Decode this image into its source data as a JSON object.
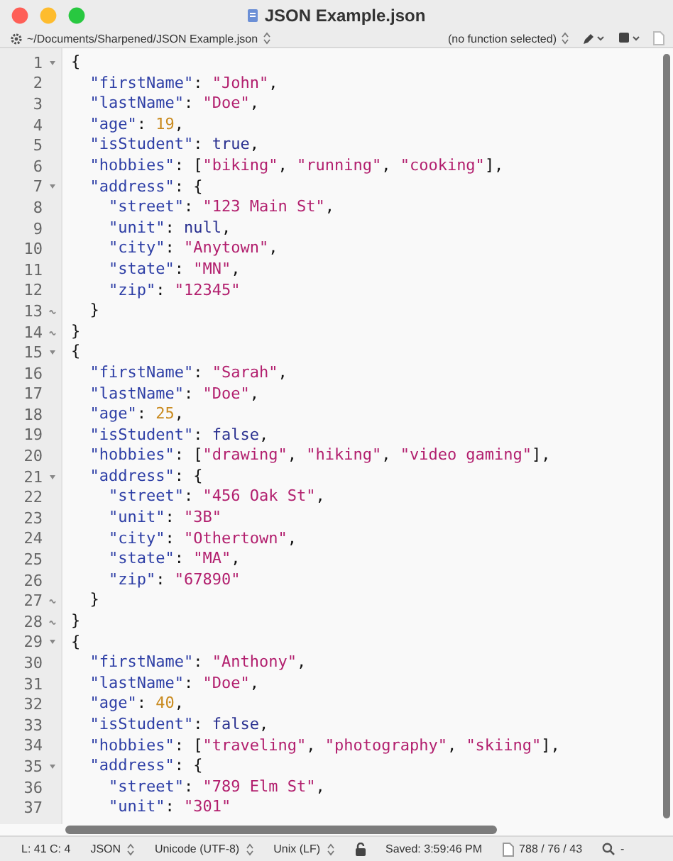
{
  "window": {
    "title": "JSON Example.json"
  },
  "path_bar": {
    "path": "~/Documents/Sharpened/JSON Example.json",
    "function_menu": "(no function selected)"
  },
  "editor": {
    "lines": [
      {
        "number": "1",
        "fold_start": true,
        "tokens": [
          {
            "kind": "punct",
            "text": "{"
          }
        ]
      },
      {
        "number": "2",
        "tokens": [
          {
            "kind": "key",
            "text": "  \"firstName\""
          },
          {
            "kind": "punct",
            "text": ": "
          },
          {
            "kind": "string",
            "text": "\"John\""
          },
          {
            "kind": "punct",
            "text": ","
          }
        ]
      },
      {
        "number": "3",
        "tokens": [
          {
            "kind": "key",
            "text": "  \"lastName\""
          },
          {
            "kind": "punct",
            "text": ": "
          },
          {
            "kind": "string",
            "text": "\"Doe\""
          },
          {
            "kind": "punct",
            "text": ","
          }
        ]
      },
      {
        "number": "4",
        "tokens": [
          {
            "kind": "key",
            "text": "  \"age\""
          },
          {
            "kind": "punct",
            "text": ": "
          },
          {
            "kind": "number",
            "text": "19"
          },
          {
            "kind": "punct",
            "text": ","
          }
        ]
      },
      {
        "number": "5",
        "tokens": [
          {
            "kind": "key",
            "text": "  \"isStudent\""
          },
          {
            "kind": "punct",
            "text": ": "
          },
          {
            "kind": "keyword",
            "text": "true"
          },
          {
            "kind": "punct",
            "text": ","
          }
        ]
      },
      {
        "number": "6",
        "tokens": [
          {
            "kind": "key",
            "text": "  \"hobbies\""
          },
          {
            "kind": "punct",
            "text": ": ["
          },
          {
            "kind": "string",
            "text": "\"biking\""
          },
          {
            "kind": "punct",
            "text": ", "
          },
          {
            "kind": "string",
            "text": "\"running\""
          },
          {
            "kind": "punct",
            "text": ", "
          },
          {
            "kind": "string",
            "text": "\"cooking\""
          },
          {
            "kind": "punct",
            "text": "],"
          }
        ]
      },
      {
        "number": "7",
        "fold_start": true,
        "tokens": [
          {
            "kind": "key",
            "text": "  \"address\""
          },
          {
            "kind": "punct",
            "text": ": {"
          }
        ]
      },
      {
        "number": "8",
        "tokens": [
          {
            "kind": "key",
            "text": "    \"street\""
          },
          {
            "kind": "punct",
            "text": ": "
          },
          {
            "kind": "string",
            "text": "\"123 Main St\""
          },
          {
            "kind": "punct",
            "text": ","
          }
        ]
      },
      {
        "number": "9",
        "tokens": [
          {
            "kind": "key",
            "text": "    \"unit\""
          },
          {
            "kind": "punct",
            "text": ": "
          },
          {
            "kind": "keyword",
            "text": "null"
          },
          {
            "kind": "punct",
            "text": ","
          }
        ]
      },
      {
        "number": "10",
        "tokens": [
          {
            "kind": "key",
            "text": "    \"city\""
          },
          {
            "kind": "punct",
            "text": ": "
          },
          {
            "kind": "string",
            "text": "\"Anytown\""
          },
          {
            "kind": "punct",
            "text": ","
          }
        ]
      },
      {
        "number": "11",
        "tokens": [
          {
            "kind": "key",
            "text": "    \"state\""
          },
          {
            "kind": "punct",
            "text": ": "
          },
          {
            "kind": "string",
            "text": "\"MN\""
          },
          {
            "kind": "punct",
            "text": ","
          }
        ]
      },
      {
        "number": "12",
        "tokens": [
          {
            "kind": "key",
            "text": "    \"zip\""
          },
          {
            "kind": "punct",
            "text": ": "
          },
          {
            "kind": "string",
            "text": "\"12345\""
          }
        ]
      },
      {
        "number": "13",
        "fold_end": true,
        "tokens": [
          {
            "kind": "punct",
            "text": "  }"
          }
        ]
      },
      {
        "number": "14",
        "fold_end": true,
        "tokens": [
          {
            "kind": "punct",
            "text": "}"
          }
        ]
      },
      {
        "number": "15",
        "fold_start": true,
        "tokens": [
          {
            "kind": "punct",
            "text": "{"
          }
        ]
      },
      {
        "number": "16",
        "tokens": [
          {
            "kind": "key",
            "text": "  \"firstName\""
          },
          {
            "kind": "punct",
            "text": ": "
          },
          {
            "kind": "string",
            "text": "\"Sarah\""
          },
          {
            "kind": "punct",
            "text": ","
          }
        ]
      },
      {
        "number": "17",
        "tokens": [
          {
            "kind": "key",
            "text": "  \"lastName\""
          },
          {
            "kind": "punct",
            "text": ": "
          },
          {
            "kind": "string",
            "text": "\"Doe\""
          },
          {
            "kind": "punct",
            "text": ","
          }
        ]
      },
      {
        "number": "18",
        "tokens": [
          {
            "kind": "key",
            "text": "  \"age\""
          },
          {
            "kind": "punct",
            "text": ": "
          },
          {
            "kind": "number",
            "text": "25"
          },
          {
            "kind": "punct",
            "text": ","
          }
        ]
      },
      {
        "number": "19",
        "tokens": [
          {
            "kind": "key",
            "text": "  \"isStudent\""
          },
          {
            "kind": "punct",
            "text": ": "
          },
          {
            "kind": "keyword",
            "text": "false"
          },
          {
            "kind": "punct",
            "text": ","
          }
        ]
      },
      {
        "number": "20",
        "tokens": [
          {
            "kind": "key",
            "text": "  \"hobbies\""
          },
          {
            "kind": "punct",
            "text": ": ["
          },
          {
            "kind": "string",
            "text": "\"drawing\""
          },
          {
            "kind": "punct",
            "text": ", "
          },
          {
            "kind": "string",
            "text": "\"hiking\""
          },
          {
            "kind": "punct",
            "text": ", "
          },
          {
            "kind": "string",
            "text": "\"video gaming\""
          },
          {
            "kind": "punct",
            "text": "],"
          }
        ]
      },
      {
        "number": "21",
        "fold_start": true,
        "tokens": [
          {
            "kind": "key",
            "text": "  \"address\""
          },
          {
            "kind": "punct",
            "text": ": {"
          }
        ]
      },
      {
        "number": "22",
        "tokens": [
          {
            "kind": "key",
            "text": "    \"street\""
          },
          {
            "kind": "punct",
            "text": ": "
          },
          {
            "kind": "string",
            "text": "\"456 Oak St\""
          },
          {
            "kind": "punct",
            "text": ","
          }
        ]
      },
      {
        "number": "23",
        "tokens": [
          {
            "kind": "key",
            "text": "    \"unit\""
          },
          {
            "kind": "punct",
            "text": ": "
          },
          {
            "kind": "string",
            "text": "\"3B\""
          }
        ]
      },
      {
        "number": "24",
        "tokens": [
          {
            "kind": "key",
            "text": "    \"city\""
          },
          {
            "kind": "punct",
            "text": ": "
          },
          {
            "kind": "string",
            "text": "\"Othertown\""
          },
          {
            "kind": "punct",
            "text": ","
          }
        ]
      },
      {
        "number": "25",
        "tokens": [
          {
            "kind": "key",
            "text": "    \"state\""
          },
          {
            "kind": "punct",
            "text": ": "
          },
          {
            "kind": "string",
            "text": "\"MA\""
          },
          {
            "kind": "punct",
            "text": ","
          }
        ]
      },
      {
        "number": "26",
        "tokens": [
          {
            "kind": "key",
            "text": "    \"zip\""
          },
          {
            "kind": "punct",
            "text": ": "
          },
          {
            "kind": "string",
            "text": "\"67890\""
          }
        ]
      },
      {
        "number": "27",
        "fold_end": true,
        "tokens": [
          {
            "kind": "punct",
            "text": "  }"
          }
        ]
      },
      {
        "number": "28",
        "fold_end": true,
        "tokens": [
          {
            "kind": "punct",
            "text": "}"
          }
        ]
      },
      {
        "number": "29",
        "fold_start": true,
        "tokens": [
          {
            "kind": "punct",
            "text": "{"
          }
        ]
      },
      {
        "number": "30",
        "tokens": [
          {
            "kind": "key",
            "text": "  \"firstName\""
          },
          {
            "kind": "punct",
            "text": ": "
          },
          {
            "kind": "string",
            "text": "\"Anthony\""
          },
          {
            "kind": "punct",
            "text": ","
          }
        ]
      },
      {
        "number": "31",
        "tokens": [
          {
            "kind": "key",
            "text": "  \"lastName\""
          },
          {
            "kind": "punct",
            "text": ": "
          },
          {
            "kind": "string",
            "text": "\"Doe\""
          },
          {
            "kind": "punct",
            "text": ","
          }
        ]
      },
      {
        "number": "32",
        "tokens": [
          {
            "kind": "key",
            "text": "  \"age\""
          },
          {
            "kind": "punct",
            "text": ": "
          },
          {
            "kind": "number",
            "text": "40"
          },
          {
            "kind": "punct",
            "text": ","
          }
        ]
      },
      {
        "number": "33",
        "tokens": [
          {
            "kind": "key",
            "text": "  \"isStudent\""
          },
          {
            "kind": "punct",
            "text": ": "
          },
          {
            "kind": "keyword",
            "text": "false"
          },
          {
            "kind": "punct",
            "text": ","
          }
        ]
      },
      {
        "number": "34",
        "tokens": [
          {
            "kind": "key",
            "text": "  \"hobbies\""
          },
          {
            "kind": "punct",
            "text": ": ["
          },
          {
            "kind": "string",
            "text": "\"traveling\""
          },
          {
            "kind": "punct",
            "text": ", "
          },
          {
            "kind": "string",
            "text": "\"photography\""
          },
          {
            "kind": "punct",
            "text": ", "
          },
          {
            "kind": "string",
            "text": "\"skiing\""
          },
          {
            "kind": "punct",
            "text": "],"
          }
        ]
      },
      {
        "number": "35",
        "fold_start": true,
        "tokens": [
          {
            "kind": "key",
            "text": "  \"address\""
          },
          {
            "kind": "punct",
            "text": ": {"
          }
        ]
      },
      {
        "number": "36",
        "tokens": [
          {
            "kind": "key",
            "text": "    \"street\""
          },
          {
            "kind": "punct",
            "text": ": "
          },
          {
            "kind": "string",
            "text": "\"789 Elm St\""
          },
          {
            "kind": "punct",
            "text": ","
          }
        ]
      },
      {
        "number": "37",
        "tokens": [
          {
            "kind": "key",
            "text": "    \"unit\""
          },
          {
            "kind": "punct",
            "text": ": "
          },
          {
            "kind": "string",
            "text": "\"301\""
          }
        ]
      }
    ]
  },
  "status_bar": {
    "position": "L: 41 C: 4",
    "language": "JSON",
    "encoding": "Unicode (UTF-8)",
    "line_endings": "Unix (LF)",
    "saved": "Saved: 3:59:46 PM",
    "counts": "788 / 76 / 43",
    "search": "-"
  }
}
